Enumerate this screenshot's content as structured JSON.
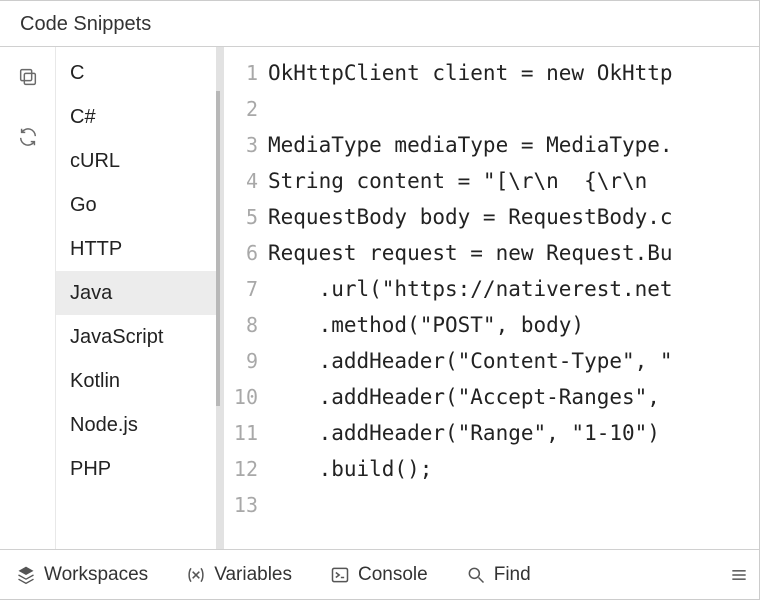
{
  "header": {
    "title": "Code Snippets"
  },
  "iconbar": {
    "copy_title": "Copy",
    "refresh_title": "Refresh"
  },
  "languages": {
    "items": [
      {
        "label": "C"
      },
      {
        "label": "C#"
      },
      {
        "label": "cURL"
      },
      {
        "label": "Go"
      },
      {
        "label": "HTTP"
      },
      {
        "label": "Java"
      },
      {
        "label": "JavaScript"
      },
      {
        "label": "Kotlin"
      },
      {
        "label": "Node.js"
      },
      {
        "label": "PHP"
      }
    ],
    "selected_index": 5
  },
  "code": {
    "lines": [
      "OkHttpClient client = new OkHttp",
      "",
      "MediaType mediaType = MediaType.",
      "String content = \"[\\r\\n  {\\r\\n  ",
      "RequestBody body = RequestBody.c",
      "Request request = new Request.Bu",
      "    .url(\"https://nativerest.net",
      "    .method(\"POST\", body)",
      "    .addHeader(\"Content-Type\", \"",
      "    .addHeader(\"Accept-Ranges\", ",
      "    .addHeader(\"Range\", \"1-10\")",
      "    .build();",
      ""
    ]
  },
  "statusbar": {
    "workspaces": "Workspaces",
    "variables": "Variables",
    "console": "Console",
    "find": "Find"
  }
}
